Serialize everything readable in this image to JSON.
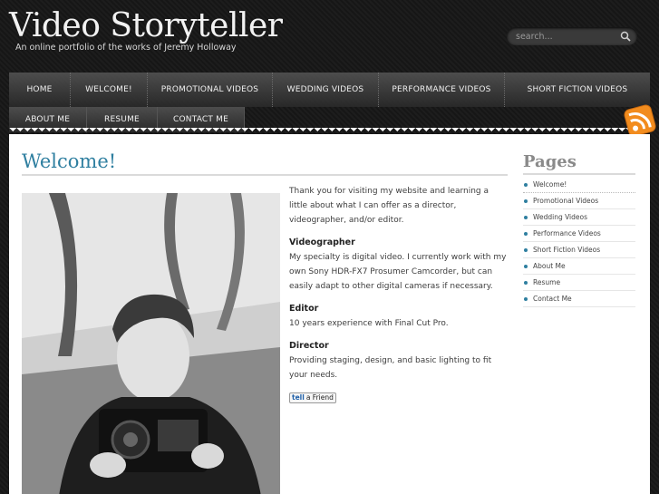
{
  "header": {
    "title": "Video Storyteller",
    "tagline": "An online portfolio of the works of Jeremy Holloway"
  },
  "search": {
    "placeholder": "search..."
  },
  "nav": {
    "row1": [
      "Home",
      "Welcome!",
      "Promotional Videos",
      "Wedding Videos",
      "Performance Videos",
      "Short Fiction Videos"
    ],
    "row2": [
      "About Me",
      "Resume",
      "Contact Me"
    ]
  },
  "main": {
    "title": "Welcome!",
    "intro": "Thank you for visiting my website and learning a little about what I can offer as a director, videographer, and/or editor.",
    "sections": [
      {
        "heading": "Videographer",
        "text": "My specialty is digital video. I currently work with my own Sony HDR-FX7 Prosumer Camcorder, but can easily adapt to other digital cameras if necessary."
      },
      {
        "heading": "Editor",
        "text": "10 years experience with Final Cut Pro."
      },
      {
        "heading": "Director",
        "text": "Providing staging, design, and basic lighting to fit your needs."
      }
    ],
    "tell_friend": {
      "tell": "tell",
      "friend": "a Friend"
    }
  },
  "sidebar": {
    "title": "Pages",
    "items": [
      "Welcome!",
      "Promotional Videos",
      "Wedding Videos",
      "Performance Videos",
      "Short Fiction Videos",
      "About Me",
      "Resume",
      "Contact Me"
    ]
  },
  "colors": {
    "accent": "#2f7fa0",
    "rss": "#f28c1e"
  },
  "icons": [
    "search-icon",
    "rss-icon"
  ]
}
